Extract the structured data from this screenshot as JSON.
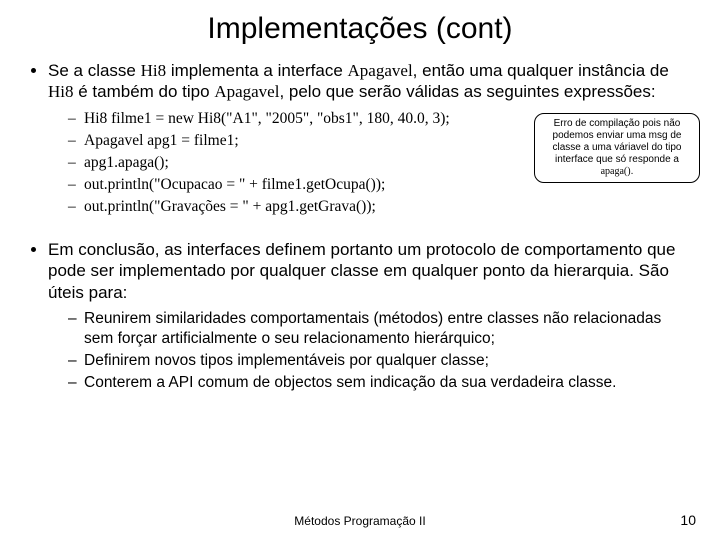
{
  "title": "Implementações (cont)",
  "bullet1": {
    "pre": "Se a classe ",
    "c1": "Hi8",
    "mid1": " implementa a interface ",
    "c2": "Apagavel",
    "mid2": ", então uma qualquer instância de ",
    "c3": "Hi8",
    "mid3": " é também do tipo ",
    "c4": "Apagavel",
    "post": ", pelo que serão válidas as seguintes expressões:"
  },
  "code": {
    "l1": "Hi8 filme1 = new Hi8(\"A1\", \"2005\", \"obs1\", 180, 40.0, 3);",
    "l2": "Apagavel apg1 = filme1;",
    "l3": "apg1.apaga();",
    "l4": "out.println(\"Ocupacao = \" + filme1.getOcupa());",
    "l5": "out.println(\"Gravações = \" + apg1.getGrava());"
  },
  "callout": {
    "t1": "Erro de compilação pois não podemos enviar uma msg de classe a uma váriavel do tipo interface que só responde a ",
    "t2": "apaga()",
    "t3": "."
  },
  "bullet2": "Em conclusão, as interfaces definem portanto um protocolo de comportamento que pode ser implementado por qualquer classe em qualquer ponto da hierarquia. São úteis para:",
  "sub": {
    "s1": "Reunirem similaridades comportamentais (métodos) entre classes não relacionadas sem forçar artificialmente o seu relacionamento hierárquico;",
    "s2": "Definirem novos tipos implementáveis por qualquer classe;",
    "s3": "Conterem a API comum de objectos sem indicação da sua verdadeira classe."
  },
  "footer": "Métodos Programação II",
  "page": "10"
}
